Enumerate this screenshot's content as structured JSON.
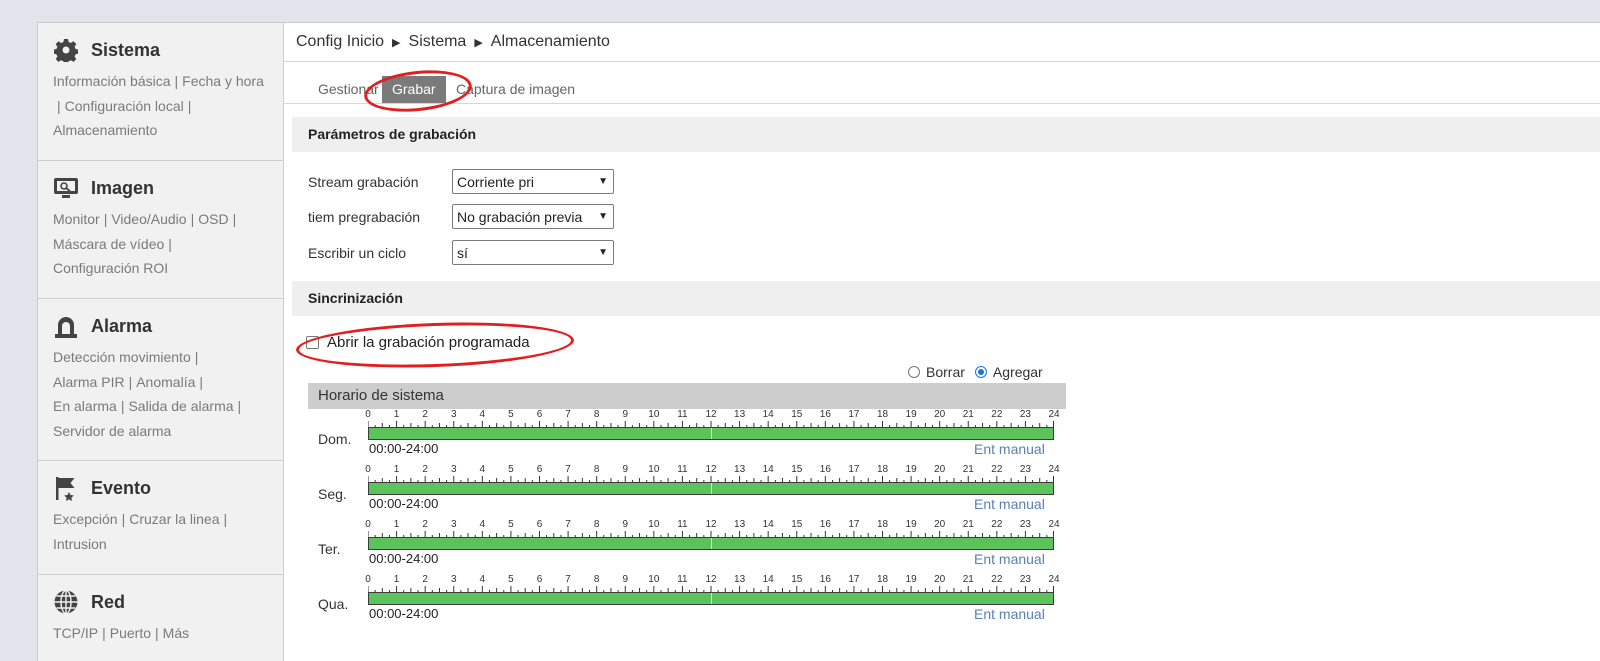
{
  "sidebar": {
    "sections": [
      {
        "title": "Sistema",
        "icon": "gear-icon",
        "links": [
          "Información básica",
          "Fecha y hora",
          "Configuración local",
          "Almacenamiento"
        ]
      },
      {
        "title": "Imagen",
        "icon": "monitor-icon",
        "links": [
          "Monitor",
          "Video/Audio",
          "OSD",
          "Máscara de vídeo",
          "Configuración ROI"
        ]
      },
      {
        "title": "Alarma",
        "icon": "alarm-light-icon",
        "links": [
          "Detección movimiento",
          "Alarma PIR",
          "Anomalía",
          "En alarma",
          "Salida de alarma",
          "Servidor de alarma"
        ]
      },
      {
        "title": "Evento",
        "icon": "event-flag-icon",
        "links": [
          "Excepción",
          "Cruzar la linea",
          "Intrusion"
        ]
      },
      {
        "title": "Red",
        "icon": "globe-icon",
        "links": [
          "TCP/IP",
          "Puerto",
          "Más"
        ]
      }
    ]
  },
  "breadcrumb": [
    "Config Inicio",
    "Sistema",
    "Almacenamiento"
  ],
  "tabs": [
    {
      "label": "Gestionar",
      "active": false
    },
    {
      "label": "Grabar",
      "active": true
    },
    {
      "label": "Captura de imagen",
      "active": false
    }
  ],
  "record_params": {
    "title": "Parámetros de grabación",
    "stream": {
      "label": "Stream grabación",
      "value": "Corriente pri"
    },
    "prerecord": {
      "label": "tiem pregrabación",
      "value": "No grabación previa"
    },
    "cycle": {
      "label": "Escribir un ciclo",
      "value": "sí"
    }
  },
  "sync": {
    "title": "Sincrinización",
    "open_schedule_label": "Abrir la grabación programada",
    "open_schedule_checked": false
  },
  "mode": {
    "erase_label": "Borrar",
    "add_label": "Agregar",
    "selected": "Agregar"
  },
  "schedule": {
    "header": "Horario de sistema",
    "hours": [
      "0",
      "1",
      "2",
      "3",
      "4",
      "5",
      "6",
      "7",
      "8",
      "9",
      "10",
      "11",
      "12",
      "13",
      "14",
      "15",
      "16",
      "17",
      "18",
      "19",
      "20",
      "21",
      "22",
      "23",
      "24"
    ],
    "manual_label": "Ent manual",
    "days": [
      {
        "label": "Dom.",
        "range": "00:00-24:00"
      },
      {
        "label": "Seg.",
        "range": "00:00-24:00"
      },
      {
        "label": "Ter.",
        "range": "00:00-24:00"
      },
      {
        "label": "Qua.",
        "range": "00:00-24:00"
      }
    ]
  },
  "colors": {
    "bar_fill": "#5cc35c",
    "annotation": "#e02020",
    "accent": "#1a73e8"
  }
}
